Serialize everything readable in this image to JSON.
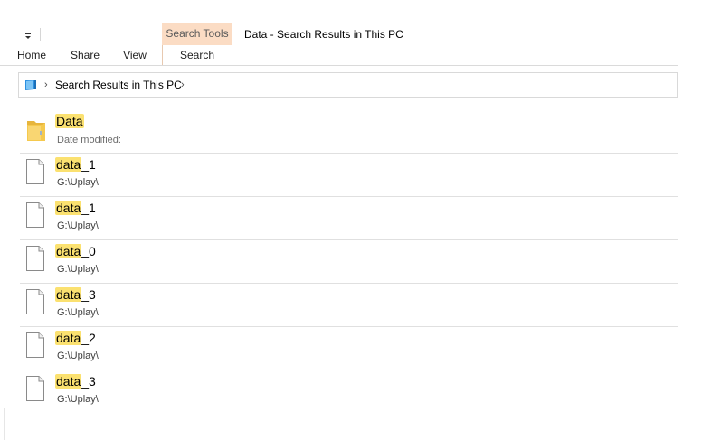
{
  "title_bar": {
    "context_tab": "Search Tools",
    "window_title": "Data - Search Results in This PC"
  },
  "ribbon": {
    "tabs": [
      {
        "label": "Home"
      },
      {
        "label": "Share"
      },
      {
        "label": "View"
      },
      {
        "label": "Search"
      }
    ]
  },
  "address_bar": {
    "icon": "this-pc-icon",
    "path": "Search Results in This PC"
  },
  "results": [
    {
      "type": "folder",
      "icon": "folder-icon",
      "name_match": "Data",
      "name_rest": "",
      "detail": "Date modified:"
    },
    {
      "type": "file",
      "icon": "file-icon",
      "name_match": "data",
      "name_rest": "_1",
      "detail": "G:\\Uplay\\"
    },
    {
      "type": "file",
      "icon": "file-icon",
      "name_match": "data",
      "name_rest": "_1",
      "detail": "G:\\Uplay\\"
    },
    {
      "type": "file",
      "icon": "file-icon",
      "name_match": "data",
      "name_rest": "_0",
      "detail": "G:\\Uplay\\"
    },
    {
      "type": "file",
      "icon": "file-icon",
      "name_match": "data",
      "name_rest": "_3",
      "detail": "G:\\Uplay\\"
    },
    {
      "type": "file",
      "icon": "file-icon",
      "name_match": "data",
      "name_rest": "_2",
      "detail": "G:\\Uplay\\"
    },
    {
      "type": "file",
      "icon": "file-icon",
      "name_match": "data",
      "name_rest": "_3",
      "detail": "G:\\Uplay\\"
    }
  ],
  "colors": {
    "highlight": "#fbe170",
    "context_tab_bg": "#fbdcc4",
    "folder_yellow": "#f5c94e"
  }
}
